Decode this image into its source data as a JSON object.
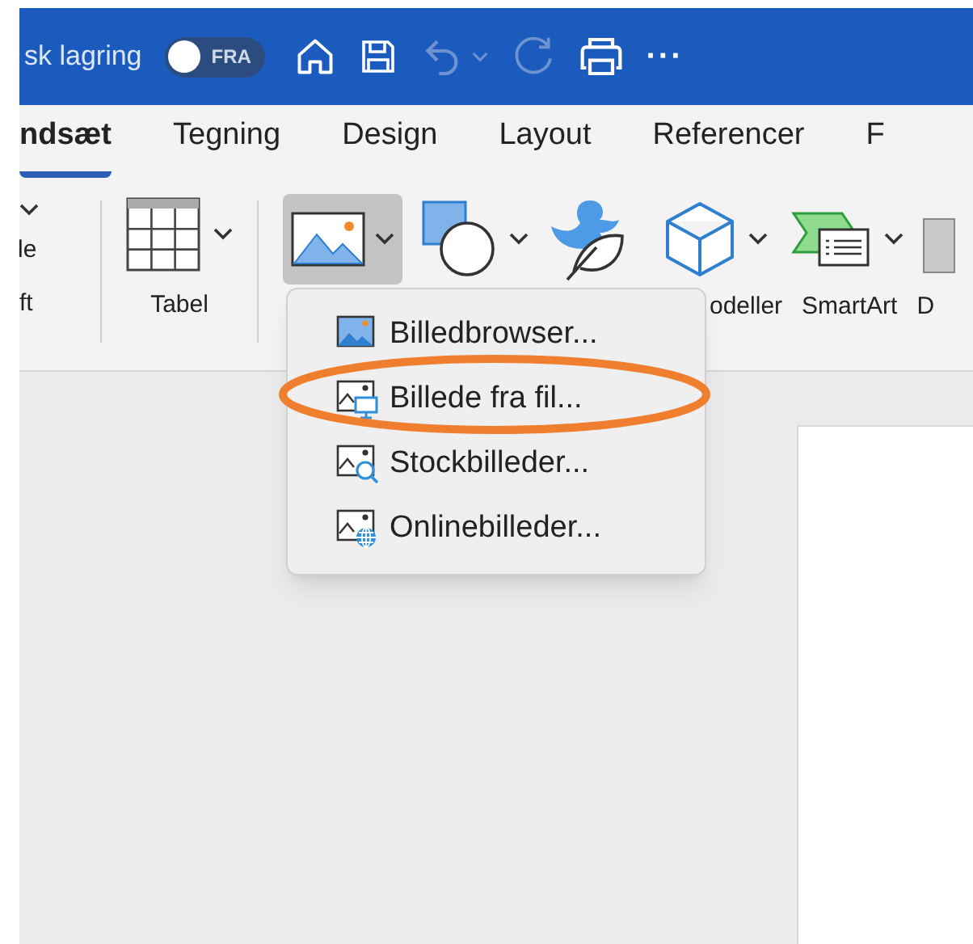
{
  "title_bar": {
    "autosave_label": "sk lagring",
    "autosave_toggle": {
      "on": false,
      "label": "FRA"
    },
    "more": "···"
  },
  "tabs": [
    {
      "label": "ndsæt",
      "selected": true
    },
    {
      "label": "Tegning",
      "selected": false
    },
    {
      "label": "Design",
      "selected": false
    },
    {
      "label": "Layout",
      "selected": false
    },
    {
      "label": "Referencer",
      "selected": false
    },
    {
      "label": "F",
      "selected": false
    }
  ],
  "ribbon": {
    "left_labels": [
      "le",
      "ft"
    ],
    "table_label": "Tabel",
    "models_label": "odeller",
    "smartart_label": "SmartArt",
    "cut_label": "D",
    "pictures_pressed": true
  },
  "menu": {
    "items": [
      {
        "label": "Billedbrowser...",
        "kind": "browser"
      },
      {
        "label": "Billede fra fil...",
        "kind": "file"
      },
      {
        "label": "Stockbilleder...",
        "kind": "stock"
      },
      {
        "label": "Onlinebilleder...",
        "kind": "online"
      }
    ]
  }
}
